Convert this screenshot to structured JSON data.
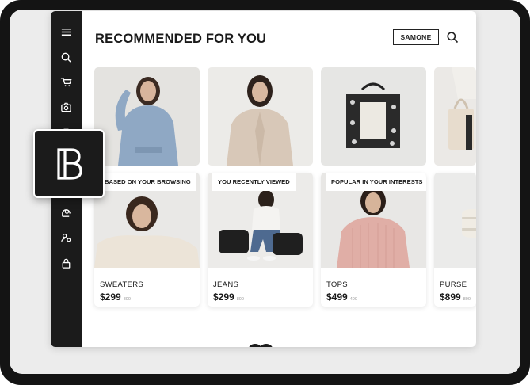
{
  "header": {
    "title": "RECOMMENDED FOR YOU",
    "user_button": "SAMONE",
    "search_icon": "search-icon"
  },
  "sidebar": {
    "icons": [
      "menu-icon",
      "search-icon",
      "cart-icon",
      "camera-icon",
      "bag-icon",
      "profile-icon",
      "people-icon",
      "lock-icon"
    ]
  },
  "logo": {
    "name": "brand-logo-icon"
  },
  "top_row": [
    {
      "name": "blue-sweater-photo"
    },
    {
      "name": "beige-cardigan-photo"
    },
    {
      "name": "tote-bag-photo"
    },
    {
      "name": "cream-bag-photo"
    }
  ],
  "cards": [
    {
      "tag": "BASED ON YOUR BROWSING",
      "category": "SWEATERS",
      "price": "$299",
      "sub": "800"
    },
    {
      "tag": "YOU RECENTLY VIEWED",
      "category": "JEANS",
      "price": "$299",
      "sub": "800"
    },
    {
      "tag": "POPULAR IN YOUR INTERESTS",
      "category": "TOPS",
      "price": "$499",
      "sub": "400"
    },
    {
      "tag": "",
      "category": "PURSE",
      "price": "$899",
      "sub": "800"
    }
  ],
  "colors": {
    "sidebar": "#1b1b1b",
    "frame": "#141414",
    "background": "#ececec"
  }
}
